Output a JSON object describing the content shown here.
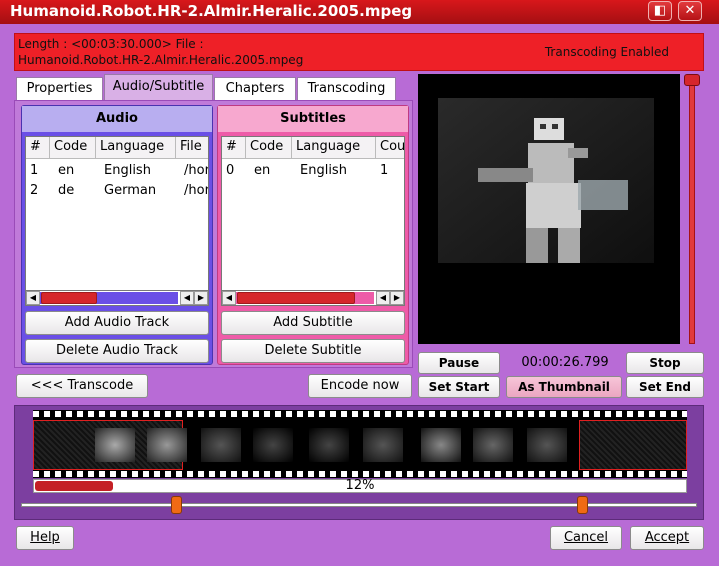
{
  "window": {
    "title": "Humanoid.Robot.HR-2.Almir.Heralic.2005.mpeg",
    "controls": [
      "◧",
      "✕"
    ]
  },
  "info": {
    "line1": "Length : <00:03:30.000> File :",
    "line2": "Humanoid.Robot.HR-2.Almir.Heralic.2005.mpeg",
    "status": "Transcoding Enabled"
  },
  "tabs": [
    {
      "label": "Properties",
      "active": false
    },
    {
      "label": "Audio/Subtitle",
      "active": true
    },
    {
      "label": "Chapters",
      "active": false
    },
    {
      "label": "Transcoding",
      "active": false
    }
  ],
  "audio": {
    "header": "Audio",
    "columns": [
      "#",
      "Code",
      "Language",
      "File"
    ],
    "rows": [
      [
        "1",
        "en",
        "English",
        "/hor"
      ],
      [
        "2",
        "de",
        "German",
        "/hor"
      ]
    ],
    "add_label": "Add Audio Track",
    "delete_label": "Delete Audio Track"
  },
  "subtitles": {
    "header": "Subtitles",
    "columns": [
      "#",
      "Code",
      "Language",
      "Cou"
    ],
    "rows": [
      [
        "0",
        "en",
        "English",
        "1"
      ]
    ],
    "add_label": "Add Subtitle",
    "delete_label": "Delete Subtitle"
  },
  "player": {
    "pause_label": "Pause",
    "timecode": "00:00:26.799",
    "stop_label": "Stop",
    "set_start_label": "Set Start",
    "as_thumbnail_label": "As Thumbnail",
    "set_end_label": "Set End"
  },
  "actions": {
    "transcode_label": "<<< Transcode",
    "encode_label": "Encode now"
  },
  "progress": {
    "percent": 12,
    "label": "12%"
  },
  "footer": {
    "help_label": "Help",
    "cancel_label": "Cancel",
    "accept_label": "Accept"
  },
  "colors": {
    "accent": "#b86bd6",
    "title_red": "#d8171b",
    "audio_blue": "#6a4fe6",
    "subtitle_pink": "#ee5ba8"
  }
}
